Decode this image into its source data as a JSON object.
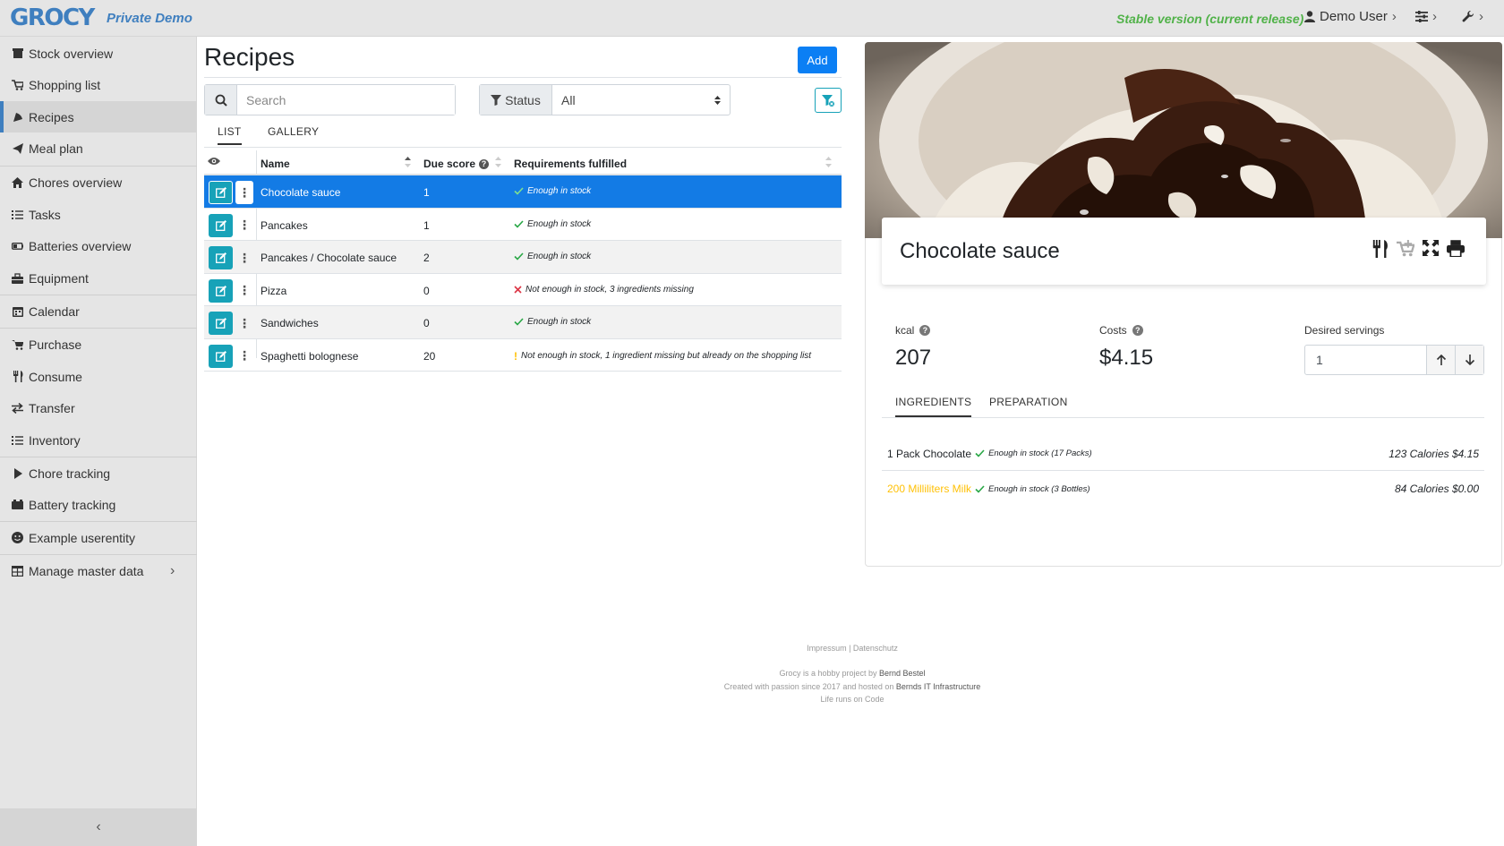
{
  "header": {
    "logo": "GROCY",
    "demo_label": "Private Demo",
    "version": "Stable version (current release)",
    "user": "Demo User"
  },
  "sidebar": {
    "items": [
      {
        "label": "Stock overview",
        "icon": "box-icon"
      },
      {
        "label": "Shopping list",
        "icon": "cart-icon"
      },
      {
        "label": "Recipes",
        "icon": "pizza-icon"
      },
      {
        "label": "Meal plan",
        "icon": "paper-plane-icon"
      },
      {
        "label": "Chores overview",
        "icon": "home-icon"
      },
      {
        "label": "Tasks",
        "icon": "tasks-icon"
      },
      {
        "label": "Batteries overview",
        "icon": "battery-icon"
      },
      {
        "label": "Equipment",
        "icon": "toolbox-icon"
      },
      {
        "label": "Calendar",
        "icon": "calendar-icon"
      },
      {
        "label": "Purchase",
        "icon": "cart-plus-icon"
      },
      {
        "label": "Consume",
        "icon": "utensils-icon"
      },
      {
        "label": "Transfer",
        "icon": "exchange-icon"
      },
      {
        "label": "Inventory",
        "icon": "list-icon"
      },
      {
        "label": "Chore tracking",
        "icon": "play-icon"
      },
      {
        "label": "Battery tracking",
        "icon": "car-battery-icon"
      },
      {
        "label": "Example userentity",
        "icon": "smile-icon"
      },
      {
        "label": "Manage master data",
        "icon": "table-icon"
      }
    ],
    "active": "Recipes"
  },
  "main": {
    "title": "Recipes",
    "add_label": "Add",
    "search_placeholder": "Search",
    "status_label": "Status",
    "status_value": "All",
    "tabs": [
      "LIST",
      "GALLERY"
    ],
    "columns": {
      "name": "Name",
      "due_score": "Due score",
      "requirements": "Requirements fulfilled"
    },
    "rows": [
      {
        "name": "Chocolate sauce",
        "due_score": "1",
        "status": "ok",
        "req": "Enough in stock"
      },
      {
        "name": "Pancakes",
        "due_score": "1",
        "status": "ok",
        "req": "Enough in stock"
      },
      {
        "name": "Pancakes / Chocolate sauce",
        "due_score": "2",
        "status": "ok",
        "req": "Enough in stock"
      },
      {
        "name": "Pizza",
        "due_score": "0",
        "status": "missing",
        "req": "Not enough in stock, 3 ingredients missing"
      },
      {
        "name": "Sandwiches",
        "due_score": "0",
        "status": "ok",
        "req": "Enough in stock"
      },
      {
        "name": "Spaghetti bolognese",
        "due_score": "20",
        "status": "warn",
        "req": "Not enough in stock, 1 ingredient missing but already on the shopping list"
      }
    ]
  },
  "detail": {
    "recipe_name": "Chocolate sauce",
    "kcal_label": "kcal",
    "kcal_value": "207",
    "costs_label": "Costs",
    "costs_value": "$4.15",
    "servings_label": "Desired servings",
    "servings_value": "1",
    "tabs": [
      "INGREDIENTS",
      "PREPARATION"
    ],
    "ingredients": [
      {
        "text": "1 Pack Chocolate",
        "note": "Enough in stock (17 Packs)",
        "right": "123 Calories  $4.15"
      },
      {
        "text": "200 Milliliters Milk",
        "note": "Enough in stock (3 Bottles)",
        "right": "84 Calories  $0.00"
      }
    ]
  },
  "footer": {
    "links": "Impressum | Datenschutz",
    "line1_pre": "Grocy is a hobby project by",
    "line1_name": "Bernd Bestel",
    "line2_pre": "Created with passion since 2017 and hosted on",
    "line2_host": "Bernds IT Infrastructure",
    "line3": "Life runs on Code"
  },
  "colors": {
    "brand": "#3f7fbf",
    "primary": "#0b7ff4",
    "info": "#17a2b8",
    "success": "#28a745",
    "danger": "#dc3545",
    "warning": "#ffc107"
  }
}
